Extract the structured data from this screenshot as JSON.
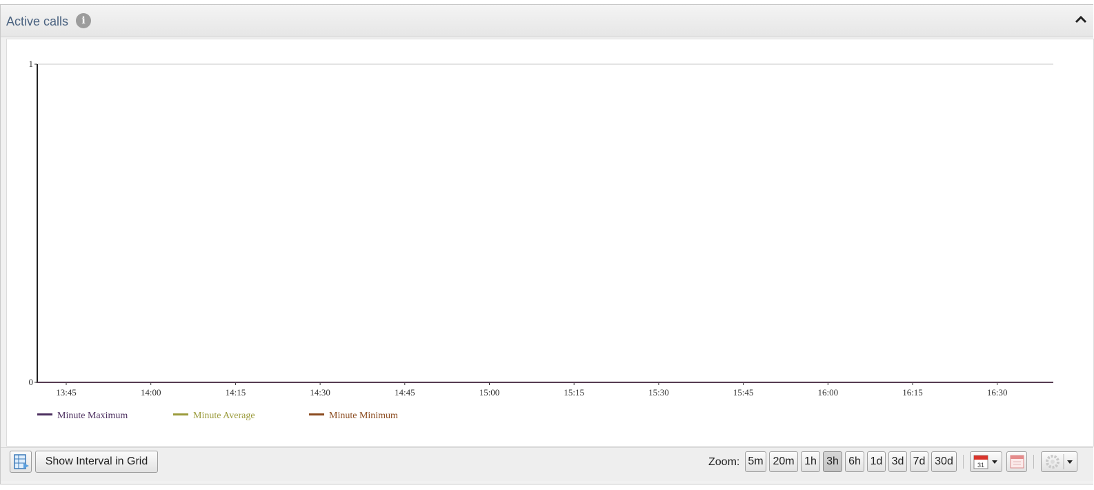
{
  "panel": {
    "title": "Active calls",
    "info_icon": "info-icon",
    "collapse_icon": "chevron-up-icon"
  },
  "chart_data": {
    "type": "line",
    "x_ticks": [
      "13:45",
      "14:00",
      "14:15",
      "14:30",
      "14:45",
      "15:00",
      "15:15",
      "15:30",
      "15:45",
      "16:00",
      "16:15",
      "16:30"
    ],
    "y_ticks": [
      0,
      1
    ],
    "ylim": [
      0,
      1
    ],
    "grid": true,
    "legend_position": "bottom-left",
    "series": [
      {
        "name": "Minute Maximum",
        "color": "#4b2e5e",
        "values": [
          0,
          0,
          0,
          0,
          0,
          0,
          0,
          0,
          0,
          0,
          0,
          0
        ]
      },
      {
        "name": "Minute Average",
        "color": "#9a9a3a",
        "values": [
          0,
          0,
          0,
          0,
          0,
          0,
          0,
          0,
          0,
          0,
          0,
          0
        ]
      },
      {
        "name": "Minute Minimum",
        "color": "#8a4a1e",
        "values": [
          0,
          0,
          0,
          0,
          0,
          0,
          0,
          0,
          0,
          0,
          0,
          0
        ]
      }
    ]
  },
  "toolbar": {
    "export_icon": "export-grid-icon",
    "show_interval_label": "Show Interval in Grid",
    "zoom_label": "Zoom:",
    "zoom_options": [
      "5m",
      "20m",
      "1h",
      "3h",
      "6h",
      "1d",
      "3d",
      "7d",
      "30d"
    ],
    "zoom_selected": "3h",
    "calendar_icon": "calendar-icon",
    "calendar_day": "31",
    "calendar_clear_icon": "calendar-clear-icon",
    "settings_icon": "gear-icon"
  }
}
